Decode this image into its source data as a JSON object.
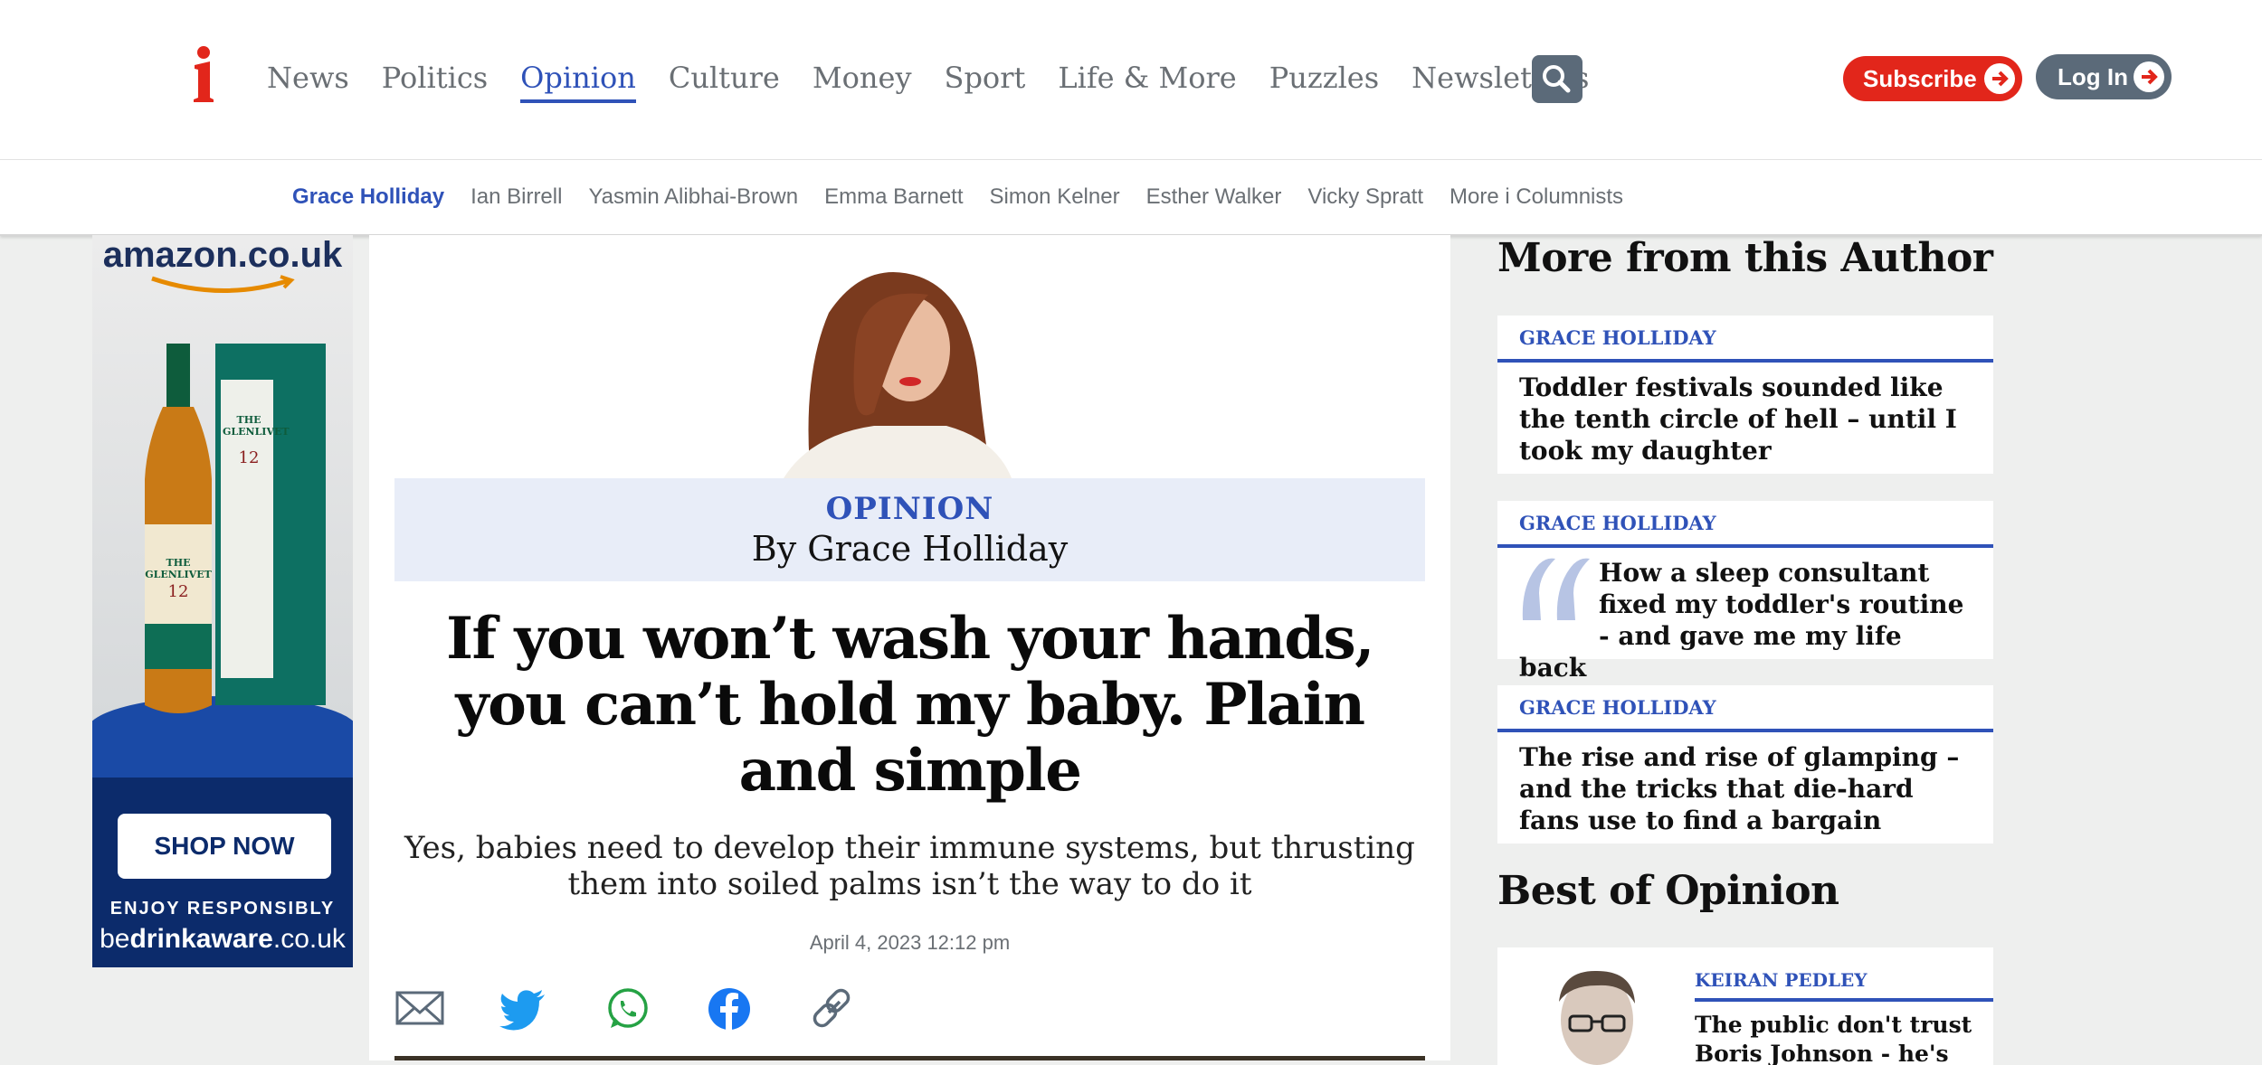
{
  "brand": {
    "logo_letter": "i",
    "accent": "#e2261b",
    "link_blue": "#2f52b8"
  },
  "nav": {
    "items": [
      {
        "label": "News",
        "active": false
      },
      {
        "label": "Politics",
        "active": false
      },
      {
        "label": "Opinion",
        "active": true
      },
      {
        "label": "Culture",
        "active": false
      },
      {
        "label": "Money",
        "active": false
      },
      {
        "label": "Sport",
        "active": false
      },
      {
        "label": "Life & More",
        "active": false
      },
      {
        "label": "Puzzles",
        "active": false
      },
      {
        "label": "Newsletters",
        "active": false
      }
    ],
    "search_icon": "search-icon",
    "subscribe_label": "Subscribe",
    "login_label": "Log In"
  },
  "subnav": {
    "items": [
      {
        "label": "Grace Holliday",
        "active": true
      },
      {
        "label": "Ian Birrell",
        "active": false
      },
      {
        "label": "Yasmin Alibhai-Brown",
        "active": false
      },
      {
        "label": "Emma Barnett",
        "active": false
      },
      {
        "label": "Simon Kelner",
        "active": false
      },
      {
        "label": "Esther Walker",
        "active": false
      },
      {
        "label": "Vicky Spratt",
        "active": false
      },
      {
        "label": "More i Columnists",
        "active": false
      }
    ]
  },
  "ad": {
    "brand": "amazon.co.uk",
    "bottle_label": "THE GLENLIVET",
    "bottle_age": "12",
    "cta": "SHOP NOW",
    "disclaimer": "ENJOY RESPONSIBLY",
    "drinkaware_prefix": "be",
    "drinkaware_bold": "drinkaware",
    "drinkaware_suffix": ".co.uk"
  },
  "article": {
    "kicker": "OPINION",
    "byline": "By Grace Holliday",
    "headline": "If you won’t wash your hands, you can’t hold my baby. Plain and simple",
    "standfirst": "Yes, babies need to develop their immune systems, but thrusting them into soiled palms isn’t the way to do it",
    "date": "April 4, 2023 12:12 pm",
    "share_icons": [
      "email-icon",
      "twitter-icon",
      "whatsapp-icon",
      "facebook-icon",
      "link-icon"
    ]
  },
  "rail": {
    "more_heading": "More from this Author",
    "cards": [
      {
        "tag": "GRACE HOLLIDAY",
        "title": "Toddler festivals sounded like the tenth circle of hell – until I took my daughter",
        "quote": false
      },
      {
        "tag": "GRACE HOLLIDAY",
        "title": "How a sleep consultant fixed my toddler's routine - and gave me my life back",
        "quote": true
      },
      {
        "tag": "GRACE HOLLIDAY",
        "title": "The rise and rise of glamping – and the tricks that die-hard fans use to find a bargain",
        "quote": false
      }
    ],
    "best_heading": "Best of Opinion",
    "best_card": {
      "tag": "KEIRAN PEDLEY",
      "title": "The public don't trust Boris Johnson - he's"
    }
  }
}
